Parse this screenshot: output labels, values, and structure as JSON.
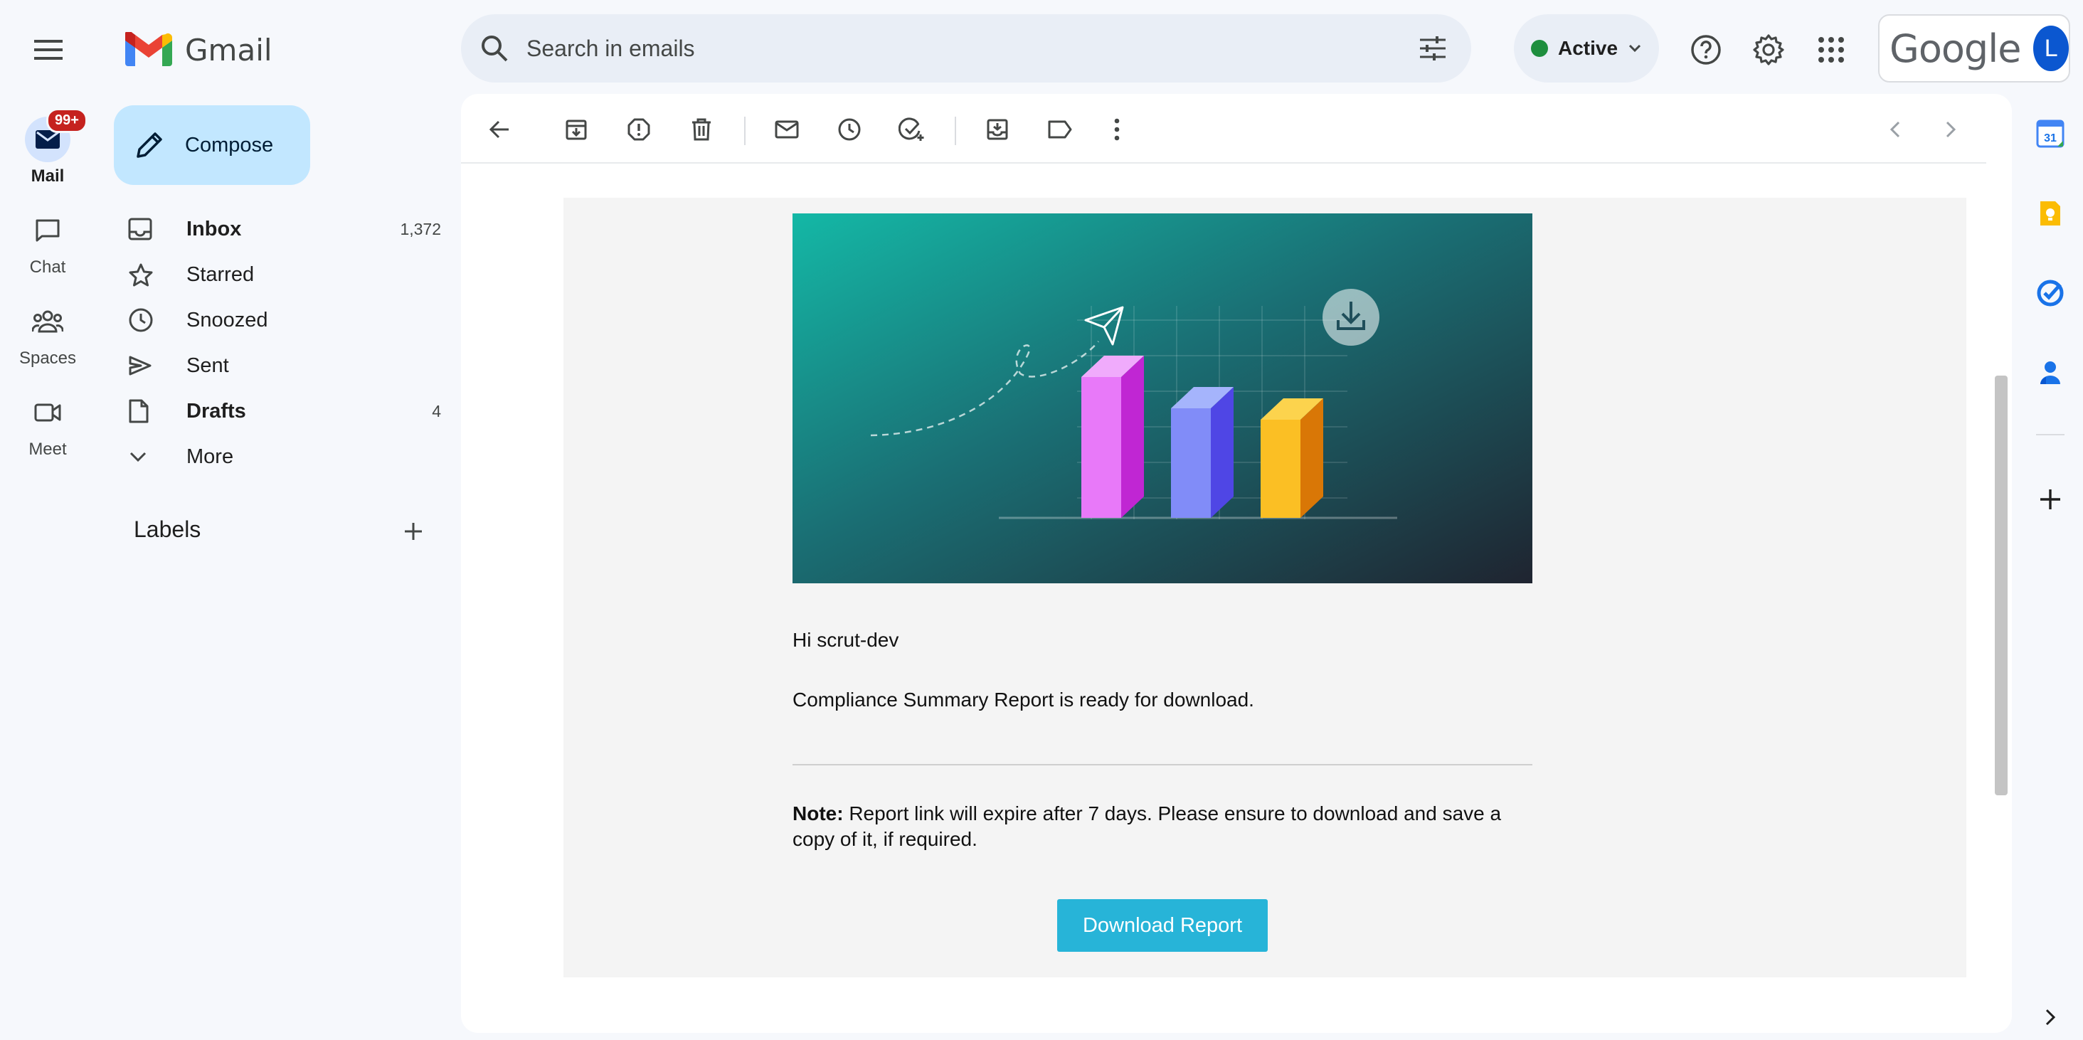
{
  "app": {
    "name": "Gmail"
  },
  "rail": {
    "items": [
      {
        "label": "Mail",
        "badge": "99+"
      },
      {
        "label": "Chat"
      },
      {
        "label": "Spaces"
      },
      {
        "label": "Meet"
      }
    ]
  },
  "compose": {
    "label": "Compose"
  },
  "nav": {
    "items": [
      {
        "label": "Inbox",
        "count": "1,372"
      },
      {
        "label": "Starred",
        "count": ""
      },
      {
        "label": "Snoozed",
        "count": ""
      },
      {
        "label": "Sent",
        "count": ""
      },
      {
        "label": "Drafts",
        "count": "4"
      },
      {
        "label": "More",
        "count": ""
      }
    ]
  },
  "labels": {
    "title": "Labels"
  },
  "search": {
    "placeholder": "Search in emails"
  },
  "status": {
    "label": "Active",
    "color": "#1e8e3e"
  },
  "account": {
    "brand": "Google",
    "avatar_letter": "L"
  },
  "email": {
    "greeting": "Hi scrut-dev",
    "message": "Compliance Summary Report is ready for download.",
    "note_label": "Note:",
    "note_text": " Report link will expire after 7 days. Please ensure to download and save a copy of it, if required.",
    "button_label": "Download Report",
    "button_color": "#27b4d8"
  },
  "side_panel": {
    "calendar_day": "31"
  }
}
